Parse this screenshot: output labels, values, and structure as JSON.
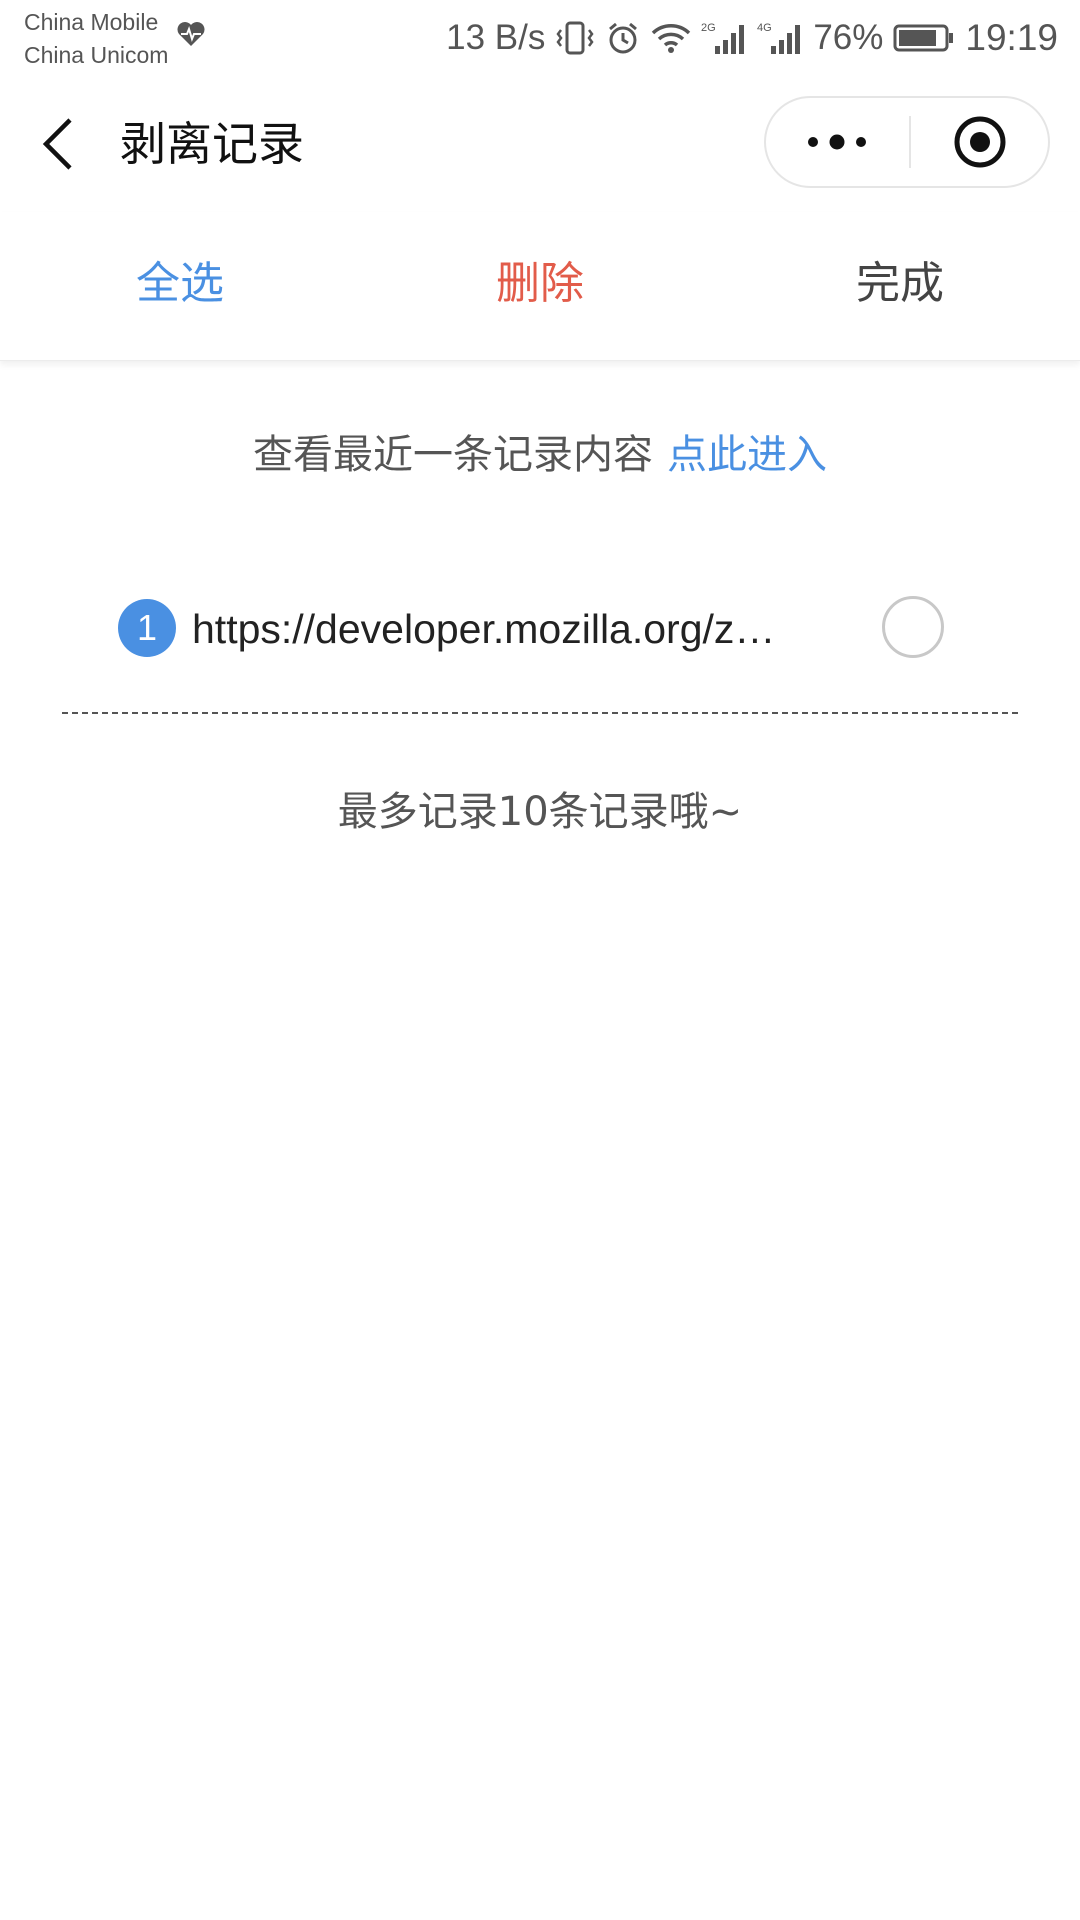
{
  "status_bar": {
    "carrier_1": "China Mobile",
    "carrier_2": "China Unicom",
    "net_speed": "13 B/s",
    "network_1": "2G",
    "network_2": "4G",
    "battery": "76%",
    "time": "19:19",
    "icons": [
      "heart-rate-icon",
      "vibrate-icon",
      "alarm-icon",
      "wifi-icon",
      "signal-icon",
      "battery-icon"
    ]
  },
  "nav": {
    "title": "剥离记录",
    "icons": [
      "back-arrow-icon",
      "more-dots-icon",
      "close-target-icon"
    ]
  },
  "toolbar": {
    "select_all": "全选",
    "delete": "删除",
    "done": "完成"
  },
  "recent": {
    "text": "查看最近一条记录内容",
    "link": "点此进入"
  },
  "records": [
    {
      "index": "1",
      "url": "https://developer.mozilla.org/zh-…"
    }
  ],
  "note": "最多记录10条记录哦~",
  "colors": {
    "accent_blue": "#4a90e2",
    "delete_red": "#e25c4a",
    "text_gray": "#555555"
  }
}
